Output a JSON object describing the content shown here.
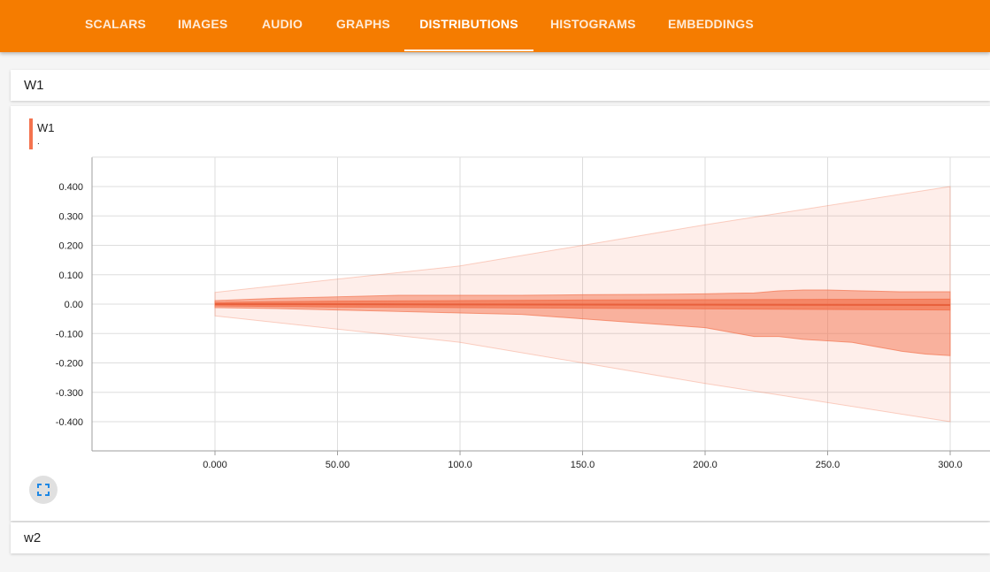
{
  "nav": {
    "tabs": [
      {
        "label": "SCALARS"
      },
      {
        "label": "IMAGES"
      },
      {
        "label": "AUDIO"
      },
      {
        "label": "GRAPHS"
      },
      {
        "label": "DISTRIBUTIONS",
        "active": true
      },
      {
        "label": "HISTOGRAMS"
      },
      {
        "label": "EMBEDDINGS"
      }
    ],
    "colors": {
      "bar": "#f57c00",
      "text": "#ffffff"
    }
  },
  "sections": [
    {
      "title": "W1"
    },
    {
      "title": "w2"
    }
  ],
  "chart_card": {
    "legend": {
      "name": "W1",
      "sub": ".",
      "color": "#f4734f"
    },
    "expand_icon": "fullscreen-icon"
  },
  "chart_data": {
    "type": "area",
    "x_ticks": [
      "0.000",
      "50.00",
      "100.0",
      "150.0",
      "200.0",
      "250.0",
      "300.0"
    ],
    "y_ticks": [
      "0.400",
      "0.300",
      "0.200",
      "0.100",
      "0.00",
      "-0.100",
      "-0.200",
      "-0.300",
      "-0.400"
    ],
    "xlim": [
      -50,
      305
    ],
    "ylim": [
      -0.5,
      0.5
    ],
    "grid": true,
    "color": "#f4734f",
    "bands": [
      {
        "name": "outer",
        "opacity": 0.12,
        "x": [
          0,
          100,
          200,
          300
        ],
        "upper": [
          0.04,
          0.13,
          0.27,
          0.4
        ],
        "lower": [
          -0.04,
          -0.13,
          -0.27,
          -0.4
        ]
      },
      {
        "name": "middle",
        "opacity": 0.5,
        "x": [
          0,
          25,
          50,
          75,
          100,
          125,
          150,
          175,
          200,
          210,
          220,
          230,
          240,
          250,
          260,
          270,
          280,
          290,
          300
        ],
        "upper": [
          0.012,
          0.02,
          0.025,
          0.03,
          0.03,
          0.03,
          0.032,
          0.033,
          0.035,
          0.037,
          0.038,
          0.045,
          0.048,
          0.048,
          0.046,
          0.044,
          0.042,
          0.042,
          0.042
        ],
        "lower": [
          -0.012,
          -0.015,
          -0.02,
          -0.025,
          -0.03,
          -0.035,
          -0.05,
          -0.065,
          -0.08,
          -0.095,
          -0.11,
          -0.11,
          -0.12,
          -0.125,
          -0.13,
          -0.145,
          -0.16,
          -0.17,
          -0.175
        ]
      },
      {
        "name": "inner",
        "opacity": 0.7,
        "x": [
          0,
          50,
          100,
          150,
          200,
          250,
          300
        ],
        "upper": [
          0.006,
          0.01,
          0.012,
          0.014,
          0.015,
          0.016,
          0.017
        ],
        "lower": [
          -0.006,
          -0.01,
          -0.012,
          -0.014,
          -0.016,
          -0.018,
          -0.02
        ]
      }
    ],
    "median": {
      "x": [
        0,
        100,
        200,
        300
      ],
      "y": [
        0,
        -0.001,
        -0.002,
        -0.003
      ]
    }
  }
}
